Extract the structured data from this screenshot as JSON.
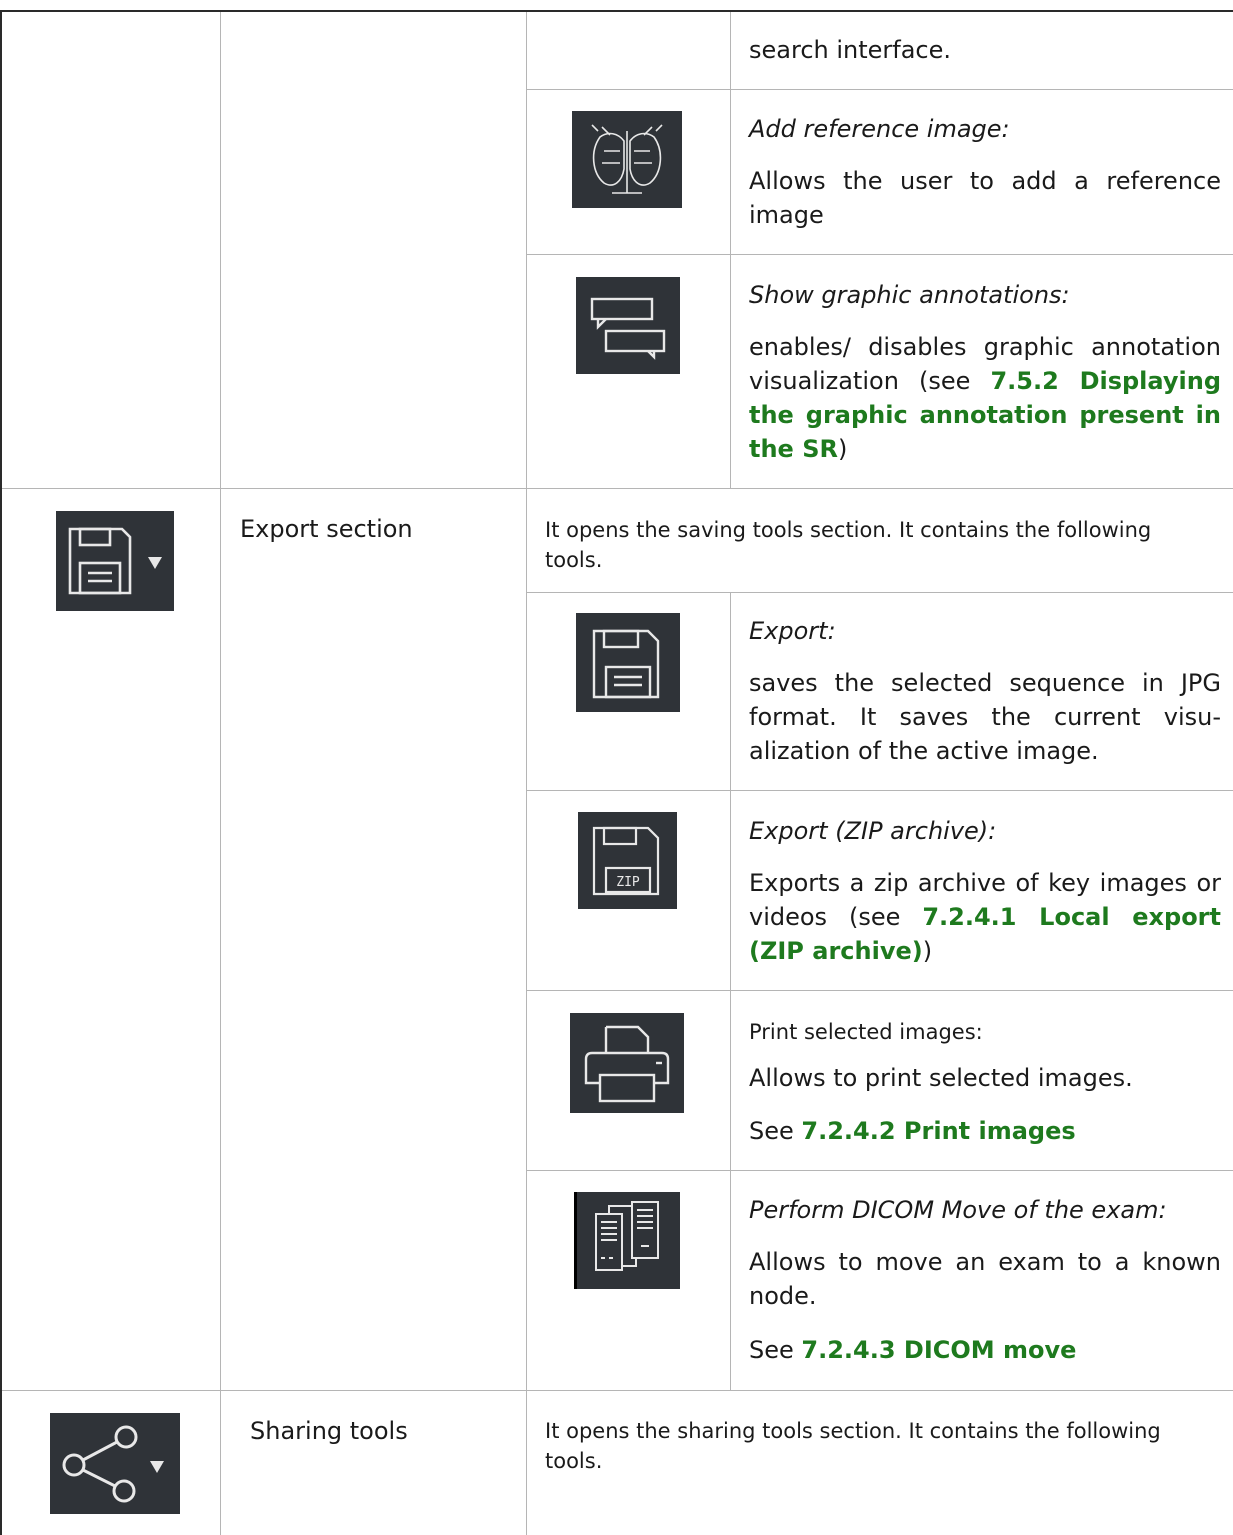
{
  "rows": {
    "search_tail": {
      "desc_text": "search interface."
    },
    "add_reference": {
      "icon": "reference-image-icon",
      "title": "Add reference image:",
      "desc": "Allows the user to add a reference image"
    },
    "graphic_annotations": {
      "icon": "annotations-icon",
      "title": "Show graphic annotations:",
      "desc_pre": "enables/ disables graphic annotation visualization (see ",
      "link": "7.5.2 Displaying the graphic annotation present in the SR",
      "desc_post": ")"
    },
    "export_section": {
      "icon": "save-dropdown-icon",
      "name": "Export section",
      "desc": "It opens the saving tools section. It contains the following tools."
    },
    "export": {
      "icon": "save-icon",
      "title": "Export:",
      "desc": "saves the selected sequence in JPG format. It saves the current visu- alization of the active image."
    },
    "export_zip": {
      "icon": "save-zip-icon",
      "icon_label": "ZIP",
      "title": "Export (ZIP archive):",
      "desc_pre": "Exports a zip archive of key images or videos (see ",
      "link": "7.2.4.1 Local export (ZIP archive)",
      "desc_post": ")"
    },
    "print": {
      "icon": "printer-icon",
      "title": "Print selected images:",
      "desc": "Allows to print selected images.",
      "see_pre": "See ",
      "link": "7.2.4.2 Print images"
    },
    "dicom_move": {
      "icon": "dicom-move-icon",
      "title": "Perform DICOM Move of the exam:",
      "desc": "Allows to move an exam to a known node.",
      "see_pre": "See ",
      "link": "7.2.4.3 DICOM move"
    },
    "sharing_tools": {
      "icon": "share-dropdown-icon",
      "name": "Sharing tools",
      "desc": "It opens the sharing tools section. It contains the following tools."
    }
  }
}
